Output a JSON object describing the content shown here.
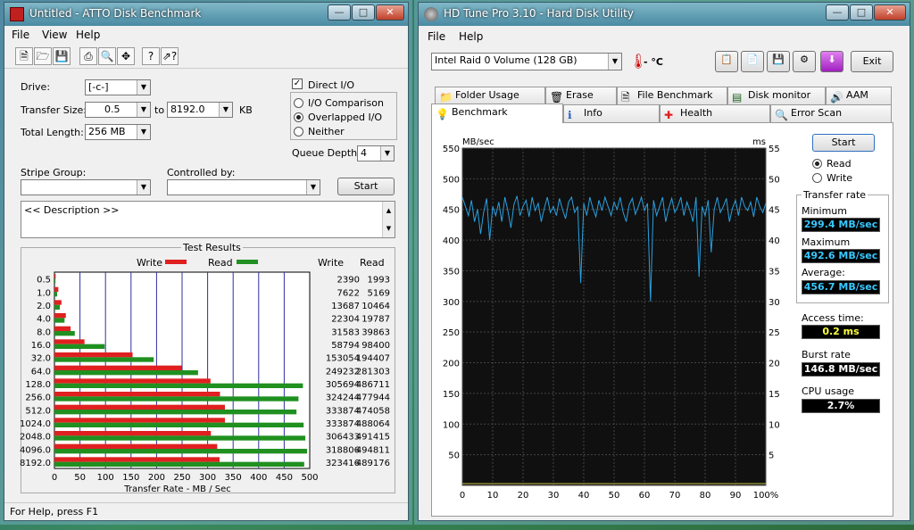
{
  "atto": {
    "title": "Untitled - ATTO Disk Benchmark",
    "menu": [
      "File",
      "View",
      "Help"
    ],
    "drive_label": "Drive:",
    "drive_value": "[-c-]",
    "transfer_label": "Transfer Size:",
    "transfer_from": "0.5",
    "to_label": "to",
    "transfer_to": "8192.0",
    "kb_label": "KB",
    "total_length_label": "Total Length:",
    "total_length": "256 MB",
    "direct_io": "Direct I/O",
    "io_comparison": "I/O Comparison",
    "overlapped_io": "Overlapped I/O",
    "neither": "Neither",
    "queue_depth_label": "Queue Depth:",
    "queue_depth": "4",
    "stripe_group_label": "Stripe Group:",
    "controlled_by_label": "Controlled by:",
    "start": "Start",
    "description": "<< Description >>",
    "test_results": "Test Results",
    "legend_write": "Write",
    "legend_read": "Read",
    "col_write": "Write",
    "col_read": "Read",
    "status": "For Help, press F1"
  },
  "hdtune": {
    "title": "HD Tune Pro 3.10 - Hard Disk Utility",
    "menu": [
      "File",
      "Help"
    ],
    "drive": "Intel   Raid 0 Volume (128 GB)",
    "temp": "- °C",
    "exit": "Exit",
    "tabs_row1": [
      "Folder Usage",
      "Erase",
      "File Benchmark",
      "Disk monitor",
      "AAM"
    ],
    "tabs_row2": [
      "Benchmark",
      "Info",
      "Health",
      "Error Scan"
    ],
    "start": "Start",
    "read": "Read",
    "write": "Write",
    "transfer_rate": "Transfer rate",
    "minimum_label": "Minimum",
    "minimum": "299.4 MB/sec",
    "maximum_label": "Maximum",
    "maximum": "492.6 MB/sec",
    "average_label": "Average:",
    "average": "456.7 MB/sec",
    "access_label": "Access time:",
    "access": "0.2 ms",
    "burst_label": "Burst rate",
    "burst": "146.8 MB/sec",
    "cpu_label": "CPU usage",
    "cpu": "2.7%"
  },
  "colors": {
    "write_bar": "#e02020",
    "read_bar": "#209020",
    "hd_line": "#2aa0e0",
    "hd_bg": "#101010",
    "stat_text": "#38c8ff",
    "access_text": "#ffff40",
    "cpu_text": "#ffffff"
  },
  "chart_data": [
    {
      "type": "bar",
      "orientation": "horizontal",
      "title": "Test Results",
      "xlabel": "Transfer Rate - MB / Sec",
      "xlim": [
        0,
        500
      ],
      "xticks": [
        0,
        50,
        100,
        150,
        200,
        250,
        300,
        350,
        400,
        450,
        500
      ],
      "categories": [
        "0.5",
        "1.0",
        "2.0",
        "4.0",
        "8.0",
        "16.0",
        "32.0",
        "64.0",
        "128.0",
        "256.0",
        "512.0",
        "1024.0",
        "2048.0",
        "4096.0",
        "8192.0"
      ],
      "series": [
        {
          "name": "Write",
          "values": [
            2390,
            7622,
            13687,
            22304,
            31583,
            58794,
            153054,
            249232,
            305694,
            324244,
            333874,
            333874,
            306433,
            318806,
            323416
          ]
        },
        {
          "name": "Read",
          "values": [
            1993,
            5169,
            10464,
            19787,
            39863,
            98400,
            194407,
            281303,
            486711,
            477944,
            474058,
            488064,
            491415,
            494811,
            489176
          ]
        }
      ],
      "legend": "top"
    },
    {
      "type": "line",
      "ylabel": "MB/sec",
      "y2label": "ms",
      "ylim": [
        0,
        550
      ],
      "y2lim": [
        0,
        55
      ],
      "yticks": [
        50,
        100,
        150,
        200,
        250,
        300,
        350,
        400,
        450,
        500,
        550
      ],
      "y2ticks": [
        5,
        10,
        15,
        20,
        25,
        30,
        35,
        40,
        45,
        50,
        55
      ],
      "xlim": [
        0,
        100
      ],
      "xticks": [
        "0",
        "10",
        "20",
        "30",
        "40",
        "50",
        "60",
        "70",
        "80",
        "90",
        "100%"
      ],
      "series": [
        {
          "name": "Read",
          "x": [
            0,
            1,
            2,
            3,
            4,
            5,
            6,
            7,
            8,
            9,
            10,
            11,
            12,
            13,
            14,
            15,
            16,
            17,
            18,
            19,
            20,
            21,
            22,
            23,
            24,
            25,
            26,
            27,
            28,
            29,
            30,
            31,
            32,
            33,
            34,
            35,
            36,
            37,
            38,
            39,
            40,
            41,
            42,
            43,
            44,
            45,
            46,
            47,
            48,
            49,
            50,
            51,
            52,
            53,
            54,
            55,
            56,
            57,
            58,
            59,
            60,
            61,
            62,
            63,
            64,
            65,
            66,
            67,
            68,
            69,
            70,
            71,
            72,
            73,
            74,
            75,
            76,
            77,
            78,
            79,
            80,
            81,
            82,
            83,
            84,
            85,
            86,
            87,
            88,
            89,
            90,
            91,
            92,
            93,
            94,
            95,
            96,
            97,
            98,
            99,
            100
          ],
          "values": [
            470,
            455,
            440,
            465,
            430,
            450,
            410,
            445,
            468,
            400,
            455,
            440,
            462,
            430,
            470,
            448,
            420,
            458,
            472,
            440,
            455,
            465,
            438,
            470,
            448,
            460,
            430,
            452,
            470,
            445,
            455,
            440,
            468,
            450,
            435,
            462,
            470,
            445,
            455,
            330,
            460,
            440,
            470,
            452,
            438,
            465,
            448,
            470,
            455,
            440,
            462,
            450,
            470,
            445,
            430,
            458,
            468,
            442,
            455,
            470,
            448,
            460,
            300,
            465,
            440,
            455,
            470,
            430,
            452,
            468,
            445,
            455,
            470,
            440,
            462,
            448,
            430,
            470,
            340,
            455,
            440,
            465,
            380,
            450,
            470,
            445,
            455,
            468,
            430,
            452,
            465,
            440,
            470,
            455,
            448,
            462,
            438,
            470,
            455,
            445,
            460
          ]
        }
      ]
    }
  ]
}
